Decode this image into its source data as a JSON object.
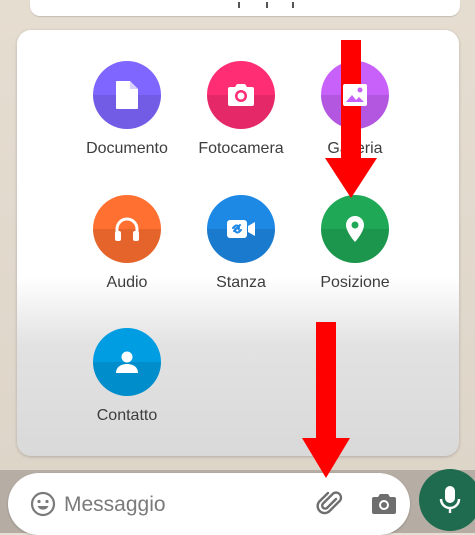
{
  "attach_menu": {
    "items": [
      {
        "label": "Documento",
        "icon": "document-icon",
        "color": "#7f66ff"
      },
      {
        "label": "Fotocamera",
        "icon": "camera-icon",
        "color": "#ff2e74"
      },
      {
        "label": "Galleria",
        "icon": "gallery-icon",
        "color": "#c861fa"
      },
      {
        "label": "Audio",
        "icon": "headphones-icon",
        "color": "#ff7031"
      },
      {
        "label": "Stanza",
        "icon": "video-link-icon",
        "color": "#1e88e5"
      },
      {
        "label": "Posizione",
        "icon": "location-pin-icon",
        "color": "#1fa855"
      },
      {
        "label": "Contatto",
        "icon": "person-icon",
        "color": "#009de2"
      }
    ]
  },
  "composer": {
    "placeholder": "Messaggio",
    "emoji_icon": "emoji-icon",
    "attach_icon": "paperclip-icon",
    "camera_icon": "camera-icon",
    "send_icon": "microphone-icon",
    "accent": "#1f6b4f"
  },
  "annotations": {
    "arrow_color": "#ff0000"
  }
}
